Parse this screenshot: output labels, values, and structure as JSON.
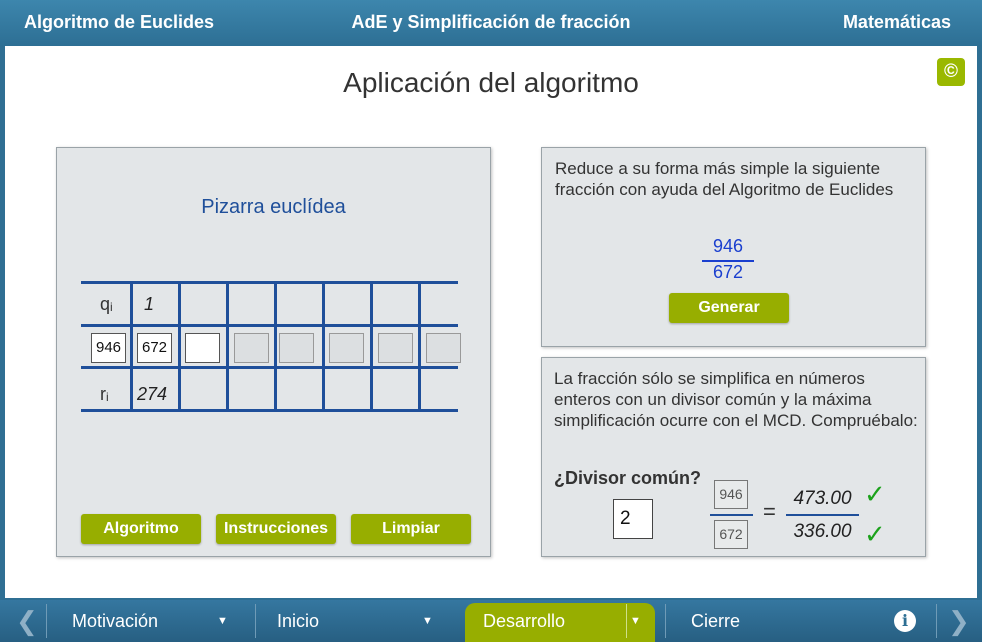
{
  "header": {
    "left_title": "Algoritmo de Euclides",
    "center_title": "AdE y Simplificación de fracción",
    "right_title": "Matemáticas"
  },
  "page": {
    "title": "Aplicación del algoritmo",
    "copyright_symbol": "©"
  },
  "board": {
    "title": "Pizarra euclídea",
    "q_label": "q",
    "q_sub": "i",
    "r_label": "r",
    "r_sub": "i",
    "q_value": "1",
    "r_value": "274",
    "cells": [
      "946",
      "672",
      "",
      "",
      "",
      "",
      "",
      ""
    ],
    "buttons": {
      "algoritmo": "Algoritmo",
      "instrucciones": "Instrucciones",
      "limpiar": "Limpiar"
    }
  },
  "problem": {
    "text": "Reduce a su forma más simple la siguiente fracción con ayuda del Algoritmo de Euclides",
    "numerator": "946",
    "denominator": "672",
    "generate_label": "Generar"
  },
  "check": {
    "text": "La fracción sólo se simplifica en números enteros con un divisor común y la máxima simplificación ocurre con el MCD. Compruébalo:",
    "divisor_label": "¿Divisor común?",
    "divisor_value": "2",
    "numerator": "946",
    "denominator": "672",
    "equals": "=",
    "result_numerator": "473.00",
    "result_denominator": "336.00",
    "check_mark": "✓"
  },
  "footer": {
    "motivacion": "Motivación",
    "inicio": "Inicio",
    "desarrollo": "Desarrollo",
    "cierre": "Cierre",
    "info_symbol": "i",
    "prev_arrow": "❮",
    "next_arrow": "❯",
    "caret": "▼"
  }
}
